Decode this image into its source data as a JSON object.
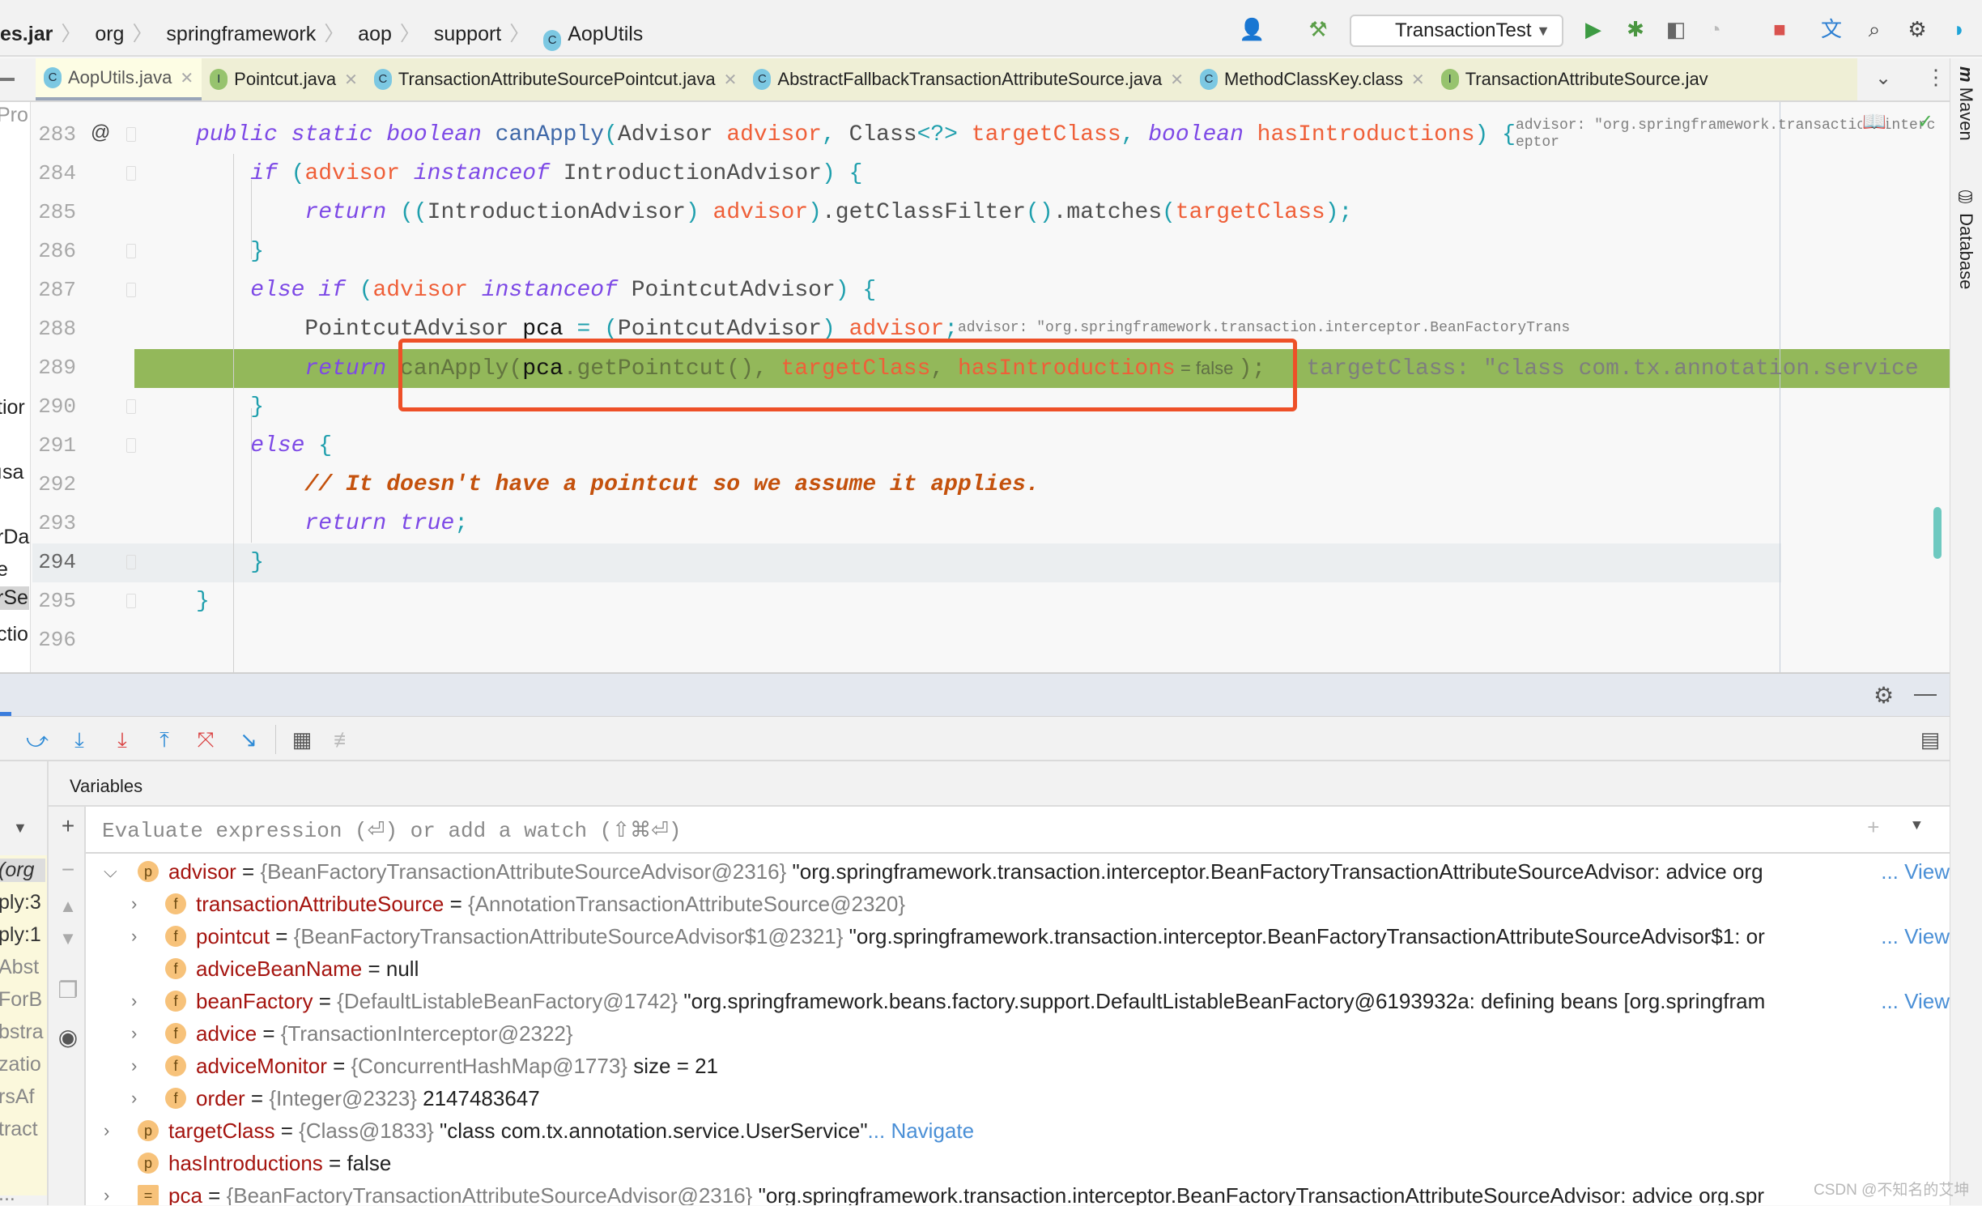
{
  "breadcrumb": [
    "es.jar",
    "org",
    "springframework",
    "aop",
    "support",
    "AopUtils"
  ],
  "toolbar": {
    "run_config": "TransactionTest",
    "icons": [
      "user-icon",
      "hammer-build-icon",
      "run-icon",
      "debug-icon",
      "coverage-icon",
      "profile-icon",
      "stop-icon",
      "translate-icon",
      "search-icon",
      "settings-icon",
      "jetbrains-logo-icon"
    ]
  },
  "tabs": [
    {
      "label": "AopUtils.java",
      "icon": "C",
      "active": true
    },
    {
      "label": "Pointcut.java",
      "icon": "I"
    },
    {
      "label": "TransactionAttributeSourcePointcut.java",
      "icon": "C"
    },
    {
      "label": "AbstractFallbackTransactionAttributeSource.java",
      "icon": "C"
    },
    {
      "label": "MethodClassKey.class",
      "icon": "C"
    },
    {
      "label": "TransactionAttributeSource.jav",
      "icon": "I"
    }
  ],
  "project_strip": [
    "Pro",
    "tior",
    "ısa",
    "rDa",
    "e",
    "rSe",
    "ctio"
  ],
  "right_strip": {
    "maven": "Maven",
    "database": "Database"
  },
  "editor": {
    "line_numbers": [
      "283",
      "284",
      "285",
      "286",
      "287",
      "288",
      "289",
      "290",
      "291",
      "292",
      "293",
      "294",
      "295",
      "296"
    ],
    "gutter_at": "@",
    "lines": [
      [
        [
          "kw",
          "public static boolean "
        ],
        [
          "decl",
          "canApply"
        ],
        [
          "br",
          "("
        ],
        [
          "",
          "Advisor "
        ],
        [
          "pa",
          "advisor"
        ],
        [
          "br",
          ", "
        ],
        [
          "",
          "Class"
        ],
        [
          "br",
          "<?> "
        ],
        [
          "pa",
          "targetClass"
        ],
        [
          "br",
          ", "
        ],
        [
          "kw",
          "boolean "
        ],
        [
          "pa",
          "hasIntroductions"
        ],
        [
          "br",
          ") {"
        ],
        [
          "hint",
          "   advisor: \"org.springframework.transaction.interceptor"
        ]
      ],
      [
        [
          "",
          "    "
        ],
        [
          "kw",
          "if "
        ],
        [
          "br",
          "("
        ],
        [
          "pa",
          "advisor "
        ],
        [
          "kw",
          "instanceof "
        ],
        [
          "",
          "IntroductionAdvisor"
        ],
        [
          "br",
          ") {"
        ]
      ],
      [
        [
          "",
          "        "
        ],
        [
          "kw",
          "return "
        ],
        [
          "br",
          "(("
        ],
        [
          "",
          "IntroductionAdvisor"
        ],
        [
          "br",
          ") "
        ],
        [
          "pa",
          "advisor"
        ],
        [
          "br",
          ")"
        ],
        [
          "",
          ".getClassFilter"
        ],
        [
          "br",
          "()"
        ],
        [
          "",
          ".matches"
        ],
        [
          "br",
          "("
        ],
        [
          "pa",
          "targetClass"
        ],
        [
          "br",
          ");"
        ]
      ],
      [
        [
          "",
          "    "
        ],
        [
          "br",
          "}"
        ]
      ],
      [
        [
          "",
          "    "
        ],
        [
          "kw",
          "else if "
        ],
        [
          "br",
          "("
        ],
        [
          "pa",
          "advisor "
        ],
        [
          "kw",
          "instanceof "
        ],
        [
          "",
          "PointcutAdvisor"
        ],
        [
          "br",
          ") {"
        ]
      ],
      [
        [
          "",
          "        PointcutAdvisor "
        ],
        [
          "blk",
          "pca "
        ],
        [
          "br",
          "= ("
        ],
        [
          "",
          "PointcutAdvisor"
        ],
        [
          "br",
          ") "
        ],
        [
          "pa",
          "advisor"
        ],
        [
          "br",
          ";"
        ],
        [
          "hint",
          "   advisor: \"org.springframework.transaction.interceptor.BeanFactoryTrans"
        ]
      ],
      [
        [
          "",
          "        "
        ],
        [
          "kw",
          "return "
        ],
        [
          "dim",
          "canApply("
        ],
        [
          "blk",
          "pca"
        ],
        [
          "dim",
          ".getPointcut(), "
        ],
        [
          "pa",
          "targetClass"
        ],
        [
          "dim",
          ", "
        ],
        [
          "pa",
          "hasIntroductions"
        ],
        [
          "fals",
          " = false "
        ],
        [
          "dim",
          ");"
        ],
        [
          "hint",
          "   targetClass: \"class com.tx.annotation.service"
        ]
      ],
      [
        [
          "",
          "    "
        ],
        [
          "br",
          "}"
        ]
      ],
      [
        [
          "",
          "    "
        ],
        [
          "kw",
          "else "
        ],
        [
          "br",
          "{"
        ]
      ],
      [
        [
          "",
          "        "
        ],
        [
          "cm",
          "// It doesn't have a pointcut so we assume it applies."
        ]
      ],
      [
        [
          "",
          "        "
        ],
        [
          "kw",
          "return true"
        ],
        [
          "br",
          ";"
        ]
      ],
      [
        [
          "",
          "    "
        ],
        [
          "br",
          "}"
        ]
      ],
      [
        [
          "br",
          "}"
        ]
      ],
      []
    ]
  },
  "debugger": {
    "toolbar_icons": [
      "show-execution-point-icon",
      "step-over-icon",
      "step-into-icon",
      "force-step-into-icon",
      "step-out-icon",
      "drop-frame-icon",
      "run-to-cursor-icon",
      "evaluate-expression-icon",
      "trace-icon"
    ],
    "variables_title": "Variables",
    "eval_placeholder": "Evaluate expression (⏎) or add a watch (⇧⌘⏎)",
    "frames": [
      "(org",
      "ply:3",
      "ply:1",
      "Abst",
      "ForB",
      "bstra",
      "zatio",
      "rsAf",
      "tract",
      "..."
    ],
    "variables": [
      {
        "level": 0,
        "expand": "open",
        "icon": "p",
        "name": "advisor",
        "type": "{BeanFactoryTransactionAttributeSourceAdvisor@2316}",
        "value": "\"org.springframework.transaction.interceptor.BeanFactoryTransactionAttributeSourceAdvisor: advice org",
        "link": "... View"
      },
      {
        "level": 1,
        "expand": "closed",
        "icon": "f",
        "name": "transactionAttributeSource",
        "type": "{AnnotationTransactionAttributeSource@2320}",
        "value": "",
        "link": ""
      },
      {
        "level": 1,
        "expand": "closed",
        "icon": "f",
        "name": "pointcut",
        "type": "{BeanFactoryTransactionAttributeSourceAdvisor$1@2321}",
        "value": "\"org.springframework.transaction.interceptor.BeanFactoryTransactionAttributeSourceAdvisor$1: or",
        "link": "... View"
      },
      {
        "level": 1,
        "expand": "",
        "icon": "f",
        "name": "adviceBeanName",
        "type": "",
        "value": "null",
        "link": ""
      },
      {
        "level": 1,
        "expand": "closed",
        "icon": "f",
        "name": "beanFactory",
        "type": "{DefaultListableBeanFactory@1742}",
        "value": "\"org.springframework.beans.factory.support.DefaultListableBeanFactory@6193932a: defining beans [org.springfram",
        "link": "... View"
      },
      {
        "level": 1,
        "expand": "closed",
        "icon": "f",
        "name": "advice",
        "type": "{TransactionInterceptor@2322}",
        "value": "",
        "link": ""
      },
      {
        "level": 1,
        "expand": "closed",
        "icon": "f",
        "name": "adviceMonitor",
        "type": "{ConcurrentHashMap@1773}",
        "value": " size = 21",
        "link": ""
      },
      {
        "level": 1,
        "expand": "closed",
        "icon": "f",
        "name": "order",
        "type": "{Integer@2323}",
        "value": "2147483647",
        "link": ""
      },
      {
        "level": 0,
        "expand": "closed",
        "icon": "p",
        "name": "targetClass",
        "type": "{Class@1833}",
        "value": "\"class com.tx.annotation.service.UserService\"",
        "link": "... Navigate"
      },
      {
        "level": 0,
        "expand": "",
        "icon": "p",
        "name": "hasIntroductions",
        "type": "",
        "value": "false",
        "link": ""
      },
      {
        "level": 0,
        "expand": "closed",
        "icon": "=",
        "name": "pca",
        "type": "{BeanFactoryTransactionAttributeSourceAdvisor@2316}",
        "value": "\"org.springframework.transaction.interceptor.BeanFactoryTransactionAttributeSourceAdvisor: advice org.spr",
        "link": ""
      }
    ]
  },
  "watermark": "CSDN @不知名的艾坤",
  "colors": {
    "highlight": "#93b85a",
    "annotation_box": "#ee5028",
    "keyword": "#7d49e6",
    "parameter": "#ef5f38",
    "link": "#4a8fd6"
  }
}
